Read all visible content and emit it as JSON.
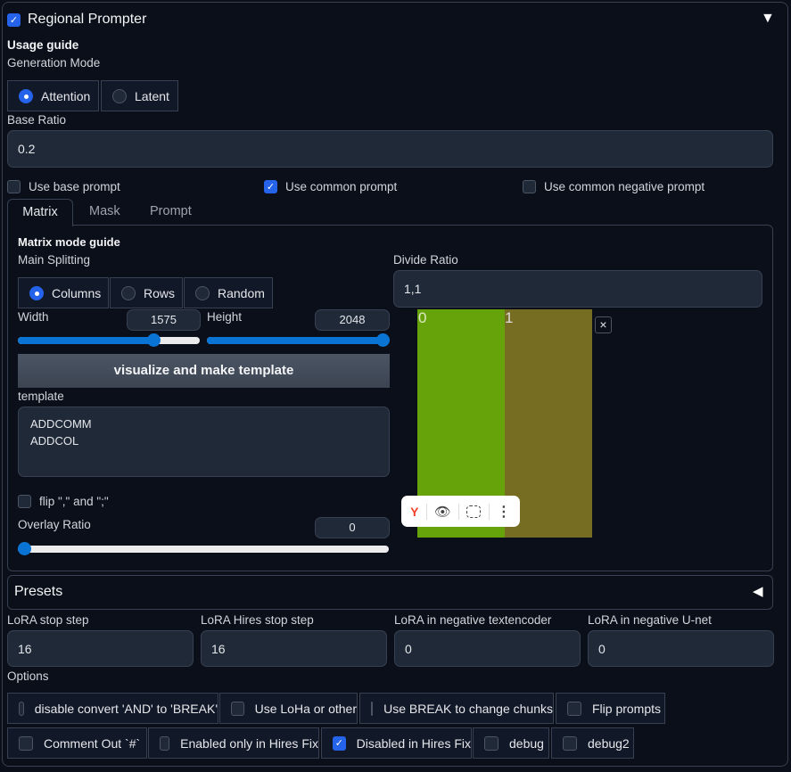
{
  "header": {
    "title": "Regional Prompter",
    "enabled": true
  },
  "usage_guide": "Usage guide",
  "generation_mode": {
    "label": "Generation Mode",
    "options": [
      "Attention",
      "Latent"
    ],
    "selected": "Attention"
  },
  "base_ratio": {
    "label": "Base Ratio",
    "value": "0.2"
  },
  "checks": {
    "base": "Use base prompt",
    "common": "Use common prompt",
    "common_neg": "Use common negative prompt"
  },
  "tabs": [
    "Matrix",
    "Mask",
    "Prompt"
  ],
  "matrix": {
    "guide": "Matrix mode guide",
    "main_splitting": {
      "label": "Main Splitting",
      "options": [
        "Columns",
        "Rows",
        "Random"
      ],
      "selected": "Columns"
    },
    "width": {
      "label": "Width",
      "value": "1575",
      "fraction": 0.75
    },
    "height": {
      "label": "Height",
      "value": "2048",
      "fraction": 1.0
    },
    "button": "visualize and make template",
    "template_label": "template",
    "template_lines": [
      "ADDCOMM",
      "ADDCOL"
    ],
    "flip_label": "flip \",\" and \";\"",
    "overlay": {
      "label": "Overlay Ratio",
      "value": "0",
      "fraction": 0
    },
    "divide_ratio": {
      "label": "Divide Ratio",
      "value": "1,1"
    },
    "preview": {
      "labels": [
        "0",
        "1"
      ],
      "colors": [
        "#66a30a",
        "#776d22"
      ],
      "close": "×"
    }
  },
  "presets": "Presets",
  "lora": [
    {
      "label": "LoRA stop step",
      "value": "16"
    },
    {
      "label": "LoRA Hires stop step",
      "value": "16"
    },
    {
      "label": "LoRA in negative textencoder",
      "value": "0"
    },
    {
      "label": "LoRA in negative U-net",
      "value": "0"
    }
  ],
  "options_label": "Options",
  "options": [
    "disable convert 'AND' to 'BREAK'",
    "Use LoHa or other",
    "Use BREAK to change chunks",
    "Flip prompts",
    "Comment Out `#`",
    "Enabled only in Hires Fix",
    "Disabled in Hires Fix",
    "debug",
    "debug2"
  ]
}
